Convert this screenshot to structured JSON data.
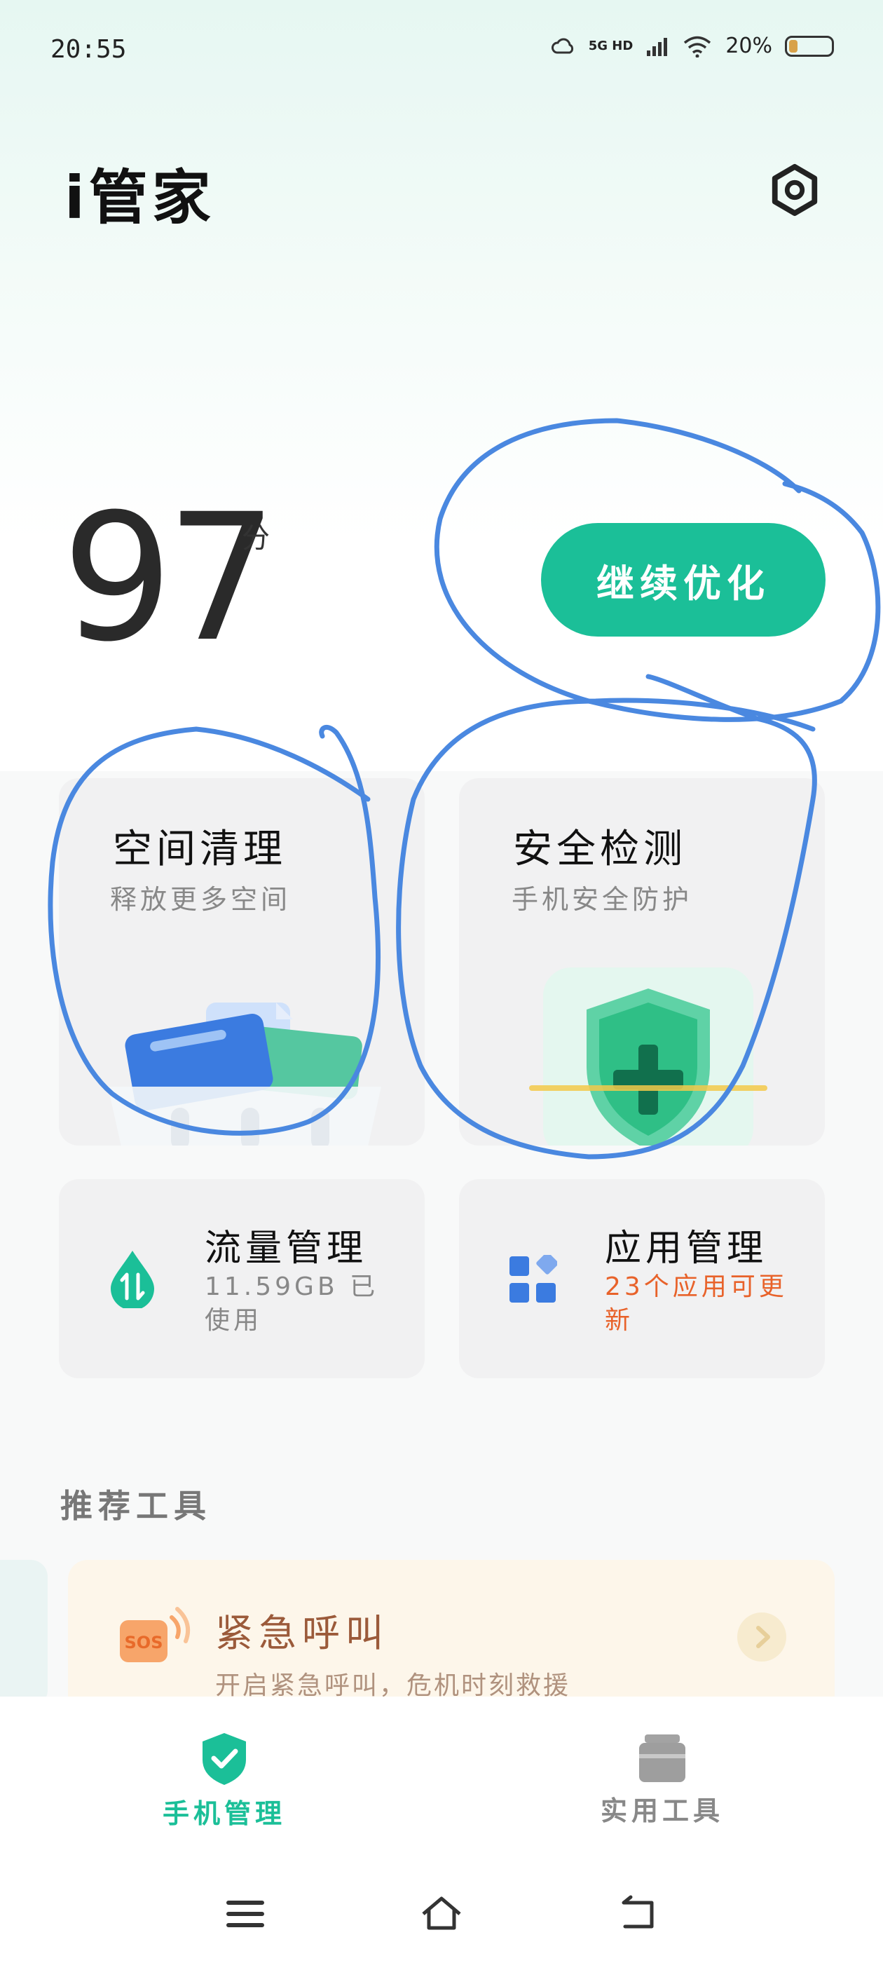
{
  "status_bar": {
    "time": "20:55",
    "network": "5G HD",
    "battery_percent": "20%",
    "battery_level": 0.2
  },
  "header": {
    "title": "i管家"
  },
  "score": {
    "value": "97",
    "unit": "分"
  },
  "optimize_button": {
    "label": "继续优化"
  },
  "cards": {
    "cleanup": {
      "title": "空间清理",
      "subtitle": "释放更多空间"
    },
    "security": {
      "title": "安全检测",
      "subtitle": "手机安全防护"
    },
    "traffic": {
      "title": "流量管理",
      "subtitle": "11.59GB 已使用"
    },
    "apps": {
      "title": "应用管理",
      "subtitle": "23个应用可更新"
    }
  },
  "section": {
    "title": "推荐工具"
  },
  "tool": {
    "title": "紧急呼叫",
    "subtitle": "开启紧急呼叫，危机时刻救援",
    "icon_text": "SOS"
  },
  "bottom_nav": {
    "items": [
      {
        "label": "手机管理",
        "active": true
      },
      {
        "label": "实用工具",
        "active": false
      }
    ]
  },
  "colors": {
    "accent": "#1bbf98",
    "warning": "#e8622a",
    "annotation": "#4a88e0"
  }
}
